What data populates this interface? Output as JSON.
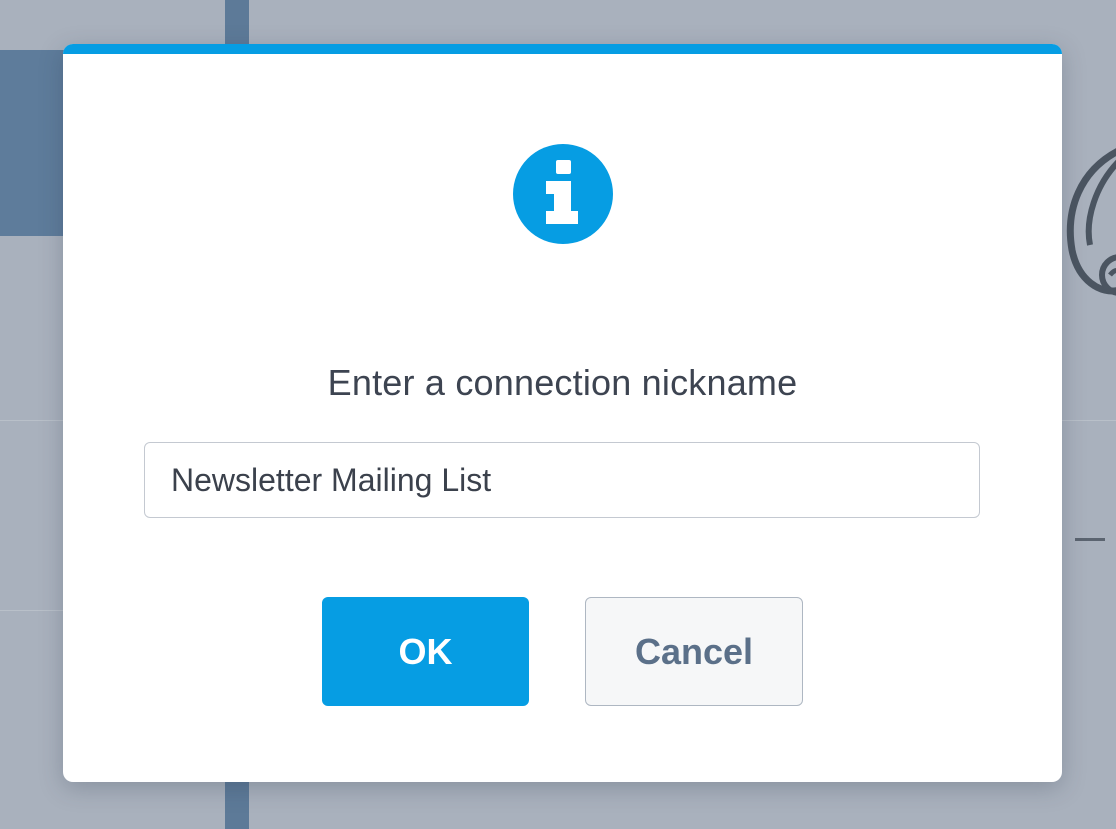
{
  "dialog": {
    "prompt": "Enter a connection nickname",
    "input": {
      "value": "Newsletter Mailing List",
      "placeholder": ""
    },
    "buttons": {
      "ok_label": "OK",
      "cancel_label": "Cancel"
    },
    "icon": "info-icon"
  },
  "colors": {
    "accent": "#069de3",
    "backdrop": "#a9b1bd",
    "cancel_text": "#5b7089",
    "text": "#3d4451"
  }
}
